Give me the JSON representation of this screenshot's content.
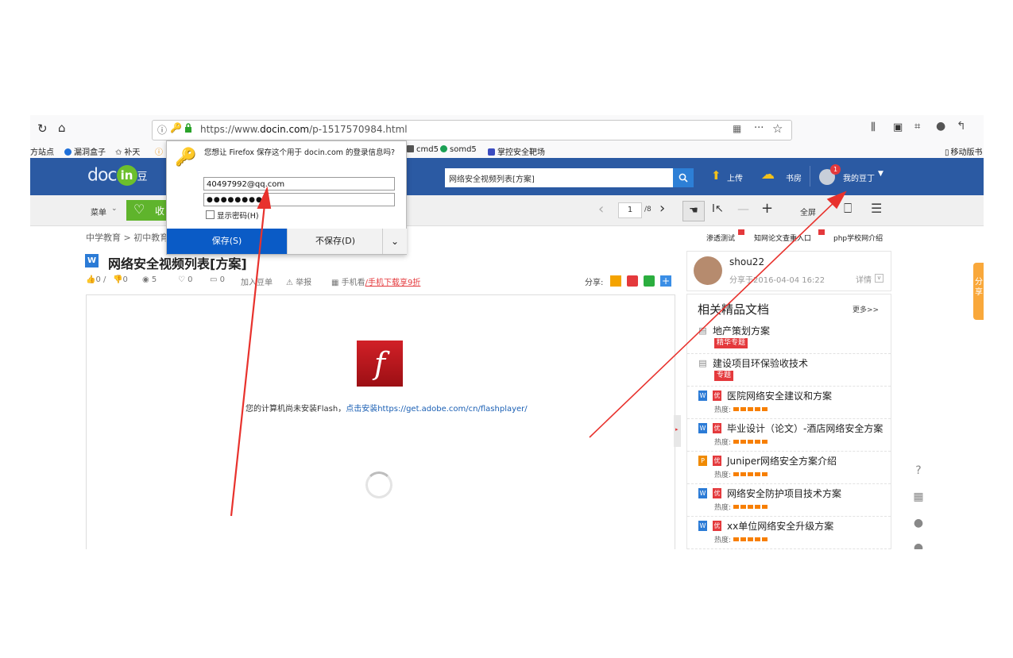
{
  "browser": {
    "url_prefix": "https://www.",
    "url_domain": "docin.com",
    "url_path": "/p-1517570984.html",
    "bookmarks": [
      "方站点",
      "漏洞盒子",
      "补天",
      "cmd5",
      "somd5",
      "掌控安全靶场"
    ],
    "mobile_bookmark": "移动版书"
  },
  "header": {
    "logo_text": "doc",
    "logo_in": "in",
    "logo_suffix": "豆",
    "search_value": "网络安全视频列表[方案]",
    "upload": "上传",
    "bookshelf": "书房",
    "my_douding": "我的豆丁",
    "notification_count": "1"
  },
  "subbar": {
    "menu": "菜单",
    "collect": "收",
    "page_current": "1",
    "page_total": "/8",
    "fullscreen": "全屏"
  },
  "breadcrumb": "中学教育 > 初中教育",
  "top_links": [
    "渗透测试",
    "知网论文查重入口",
    "php学校网介绍"
  ],
  "document": {
    "title": "网络安全视频列表[方案]",
    "meta_like": "0 / ",
    "meta_dislike": "0",
    "meta_views": "5",
    "meta_fav": "0",
    "meta_comment": "0",
    "add_list": "加入豆单",
    "report": "举报",
    "mobile_view": "手机看",
    "mobile_download": "/手机下载享9折",
    "share": "分享:"
  },
  "flash": {
    "message": "您的计算机尚未安装Flash，",
    "link": "点击安装https://get.adobe.com/cn/flashplayer/"
  },
  "author": {
    "name": "shou22",
    "shared_on": "分享于2016-04-04 16:22",
    "details": "详情"
  },
  "related": {
    "heading": "相关精品文档",
    "more": "更多>>",
    "heat_label": "热度:",
    "items": [
      {
        "title": "地产策划方案",
        "tag": "精华专题"
      },
      {
        "title": "建设项目环保验收技术",
        "tag": "专题"
      },
      {
        "title": "医院网络安全建议和方案",
        "tag": ""
      },
      {
        "title": "毕业设计（论文）-酒店网络安全方案",
        "tag": ""
      },
      {
        "title": "Juniper网络安全方案介绍",
        "tag": ""
      },
      {
        "title": "网络安全防护项目技术方案",
        "tag": ""
      },
      {
        "title": "xx单位网络安全升级方案",
        "tag": ""
      }
    ]
  },
  "side_tab": "分享",
  "password_dialog": {
    "question": "您想让 Firefox 保存这个用于 docin.com 的登录信息吗?",
    "username": "40497992@qq.com",
    "password": "●●●●●●●●",
    "show_password": "显示密码(H)",
    "save": "保存(S)",
    "dont_save": "不保存(D)"
  },
  "colors": {
    "header_blue": "#2b5aa3",
    "annotation_red": "#e8322d",
    "save_blue": "#0a5bc6"
  }
}
